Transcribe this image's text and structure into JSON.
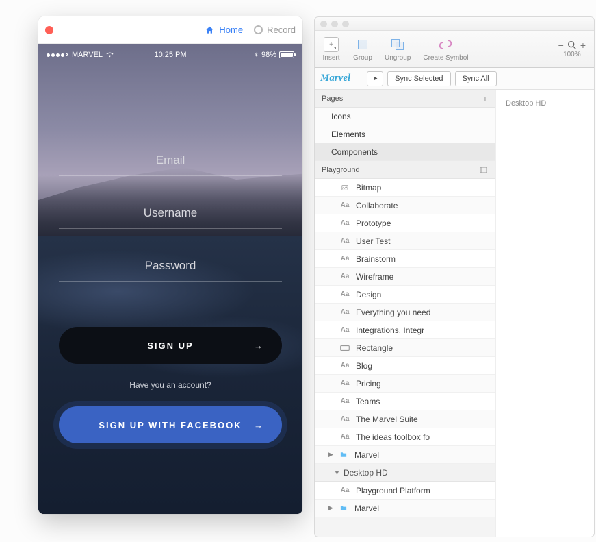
{
  "leftWindow": {
    "toolbar": {
      "home": "Home",
      "record": "Record"
    },
    "statusBar": {
      "carrier": "MARVEL",
      "time": "10:25 PM",
      "battery": "98%"
    },
    "form": {
      "email": "Email",
      "username": "Username",
      "password": "Password",
      "signup": "SIGN UP",
      "hint": "Have you an account?",
      "facebook": "SIGN UP WITH FACEBOOK"
    }
  },
  "rightWindow": {
    "toolbar": {
      "insert": "Insert",
      "group": "Group",
      "ungroup": "Ungroup",
      "createSymbol": "Create Symbol",
      "zoom": "100%"
    },
    "plugin": {
      "logo": "Marvel",
      "syncSelected": "Sync Selected",
      "syncAll": "Sync All"
    },
    "pagesHeader": "Pages",
    "pages": [
      "Icons",
      "Elements",
      "Components"
    ],
    "artboardHeader": "Playground",
    "layers": [
      {
        "type": "bitmap",
        "label": "Bitmap"
      },
      {
        "type": "text",
        "label": "Collaborate"
      },
      {
        "type": "text",
        "label": "Prototype"
      },
      {
        "type": "text",
        "label": "User Test"
      },
      {
        "type": "text",
        "label": "Brainstorm"
      },
      {
        "type": "text",
        "label": "Wireframe"
      },
      {
        "type": "text",
        "label": "Design"
      },
      {
        "type": "text",
        "label": "Everything you need"
      },
      {
        "type": "text",
        "label": "Integrations. Integr"
      },
      {
        "type": "rect",
        "label": "Rectangle"
      },
      {
        "type": "text",
        "label": "Blog"
      },
      {
        "type": "text",
        "label": "Pricing"
      },
      {
        "type": "text",
        "label": "Teams"
      },
      {
        "type": "text",
        "label": "The Marvel Suite"
      },
      {
        "type": "text",
        "label": "The ideas toolbox fo"
      },
      {
        "type": "folder",
        "label": "Marvel",
        "disclose": true
      }
    ],
    "group2": {
      "header": "Desktop HD",
      "items": [
        {
          "type": "text",
          "label": "Playground Platform"
        },
        {
          "type": "folder",
          "label": "Marvel",
          "disclose": true
        }
      ]
    },
    "canvas": {
      "label": "Desktop HD"
    }
  }
}
